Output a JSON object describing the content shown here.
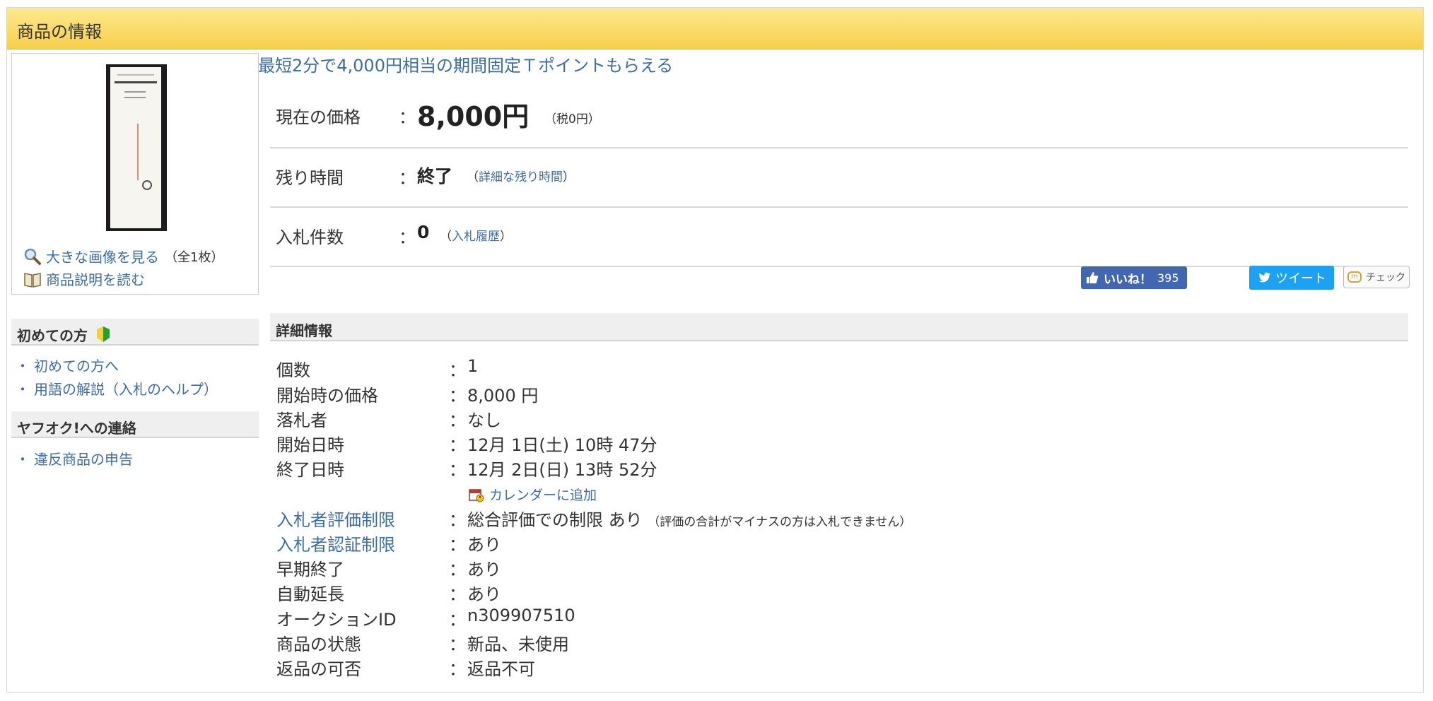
{
  "panel": {
    "title": "商品の情報"
  },
  "image_box": {
    "view_large_label": "大きな画像を見る",
    "image_count": "（全1枚）",
    "read_description_label": "商品説明を読む"
  },
  "sidebar": {
    "beginner": {
      "heading": "初めての方",
      "items": [
        "初めての方へ",
        "用語の解説（入札のヘルプ）"
      ]
    },
    "contact": {
      "heading": "ヤフオク!への連絡",
      "items": [
        "違反商品の申告"
      ]
    }
  },
  "promo_link": "最短2分で4,000円相当の期間固定Ｔポイントもらえる",
  "summary": {
    "price": {
      "label": "現在の価格",
      "value": "8,000円",
      "tax": "（税0円）"
    },
    "time_left": {
      "label": "残り時間",
      "value": "終了",
      "link_open": "（",
      "link": "詳細な残り時間",
      "link_close": "）"
    },
    "bids": {
      "label": "入札件数",
      "value": "0",
      "link_open": "（",
      "link": "入札履歴",
      "link_close": "）"
    },
    "colon": "："
  },
  "social": {
    "like_label": "いいね！",
    "like_count": "395",
    "tweet_label": "ツイート",
    "check_label": "チェック"
  },
  "details": {
    "heading": "詳細情報",
    "colon": "：",
    "rows": [
      {
        "key": "個数",
        "value": "1"
      },
      {
        "key": "開始時の価格",
        "value": "8,000 円"
      },
      {
        "key": "落札者",
        "value": "なし"
      },
      {
        "key": "開始日時",
        "value": "12月 1日(土) 10時 47分"
      },
      {
        "key": "終了日時",
        "value": "12月 2日(日) 13時 52分"
      },
      {
        "key": "入札者評価制限",
        "value": "総合評価での制限 あり",
        "note": "（評価の合計がマイナスの方は入札できません）"
      },
      {
        "key": "入札者認証制限",
        "value": "あり"
      },
      {
        "key": "早期終了",
        "value": "あり"
      },
      {
        "key": "自動延長",
        "value": "あり"
      },
      {
        "key": "オークションID",
        "value": "n309907510"
      },
      {
        "key": "商品の状態",
        "value": "新品、未使用"
      },
      {
        "key": "返品の可否",
        "value": "返品不可"
      }
    ],
    "calendar_label": "カレンダーに追加"
  },
  "colors": {
    "header_top": "#fde98f",
    "header_bottom": "#f8cf4a",
    "link": "#3c6ea3",
    "like": "#4267b2",
    "tweet": "#1da1f2"
  }
}
